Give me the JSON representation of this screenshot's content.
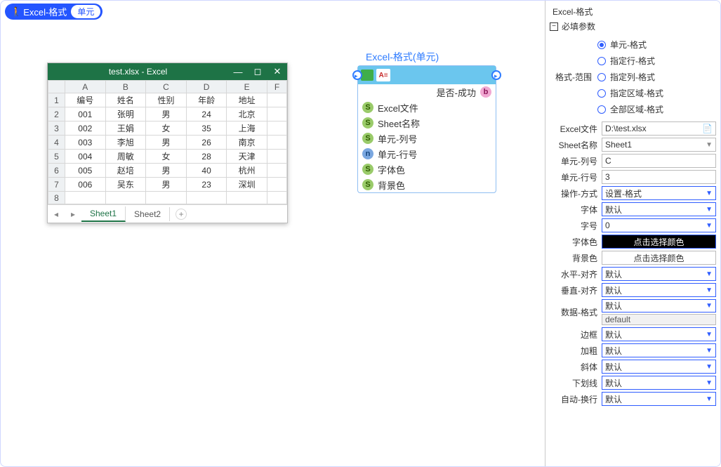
{
  "topTag": {
    "label": "Excel-格式",
    "pill": "单元"
  },
  "excel": {
    "title": "test.xlsx  -  Excel",
    "cols": [
      "A",
      "B",
      "C",
      "D",
      "E",
      "F"
    ],
    "headers": [
      "编号",
      "姓名",
      "性别",
      "年龄",
      "地址"
    ],
    "rows": [
      [
        "001",
        "张明",
        "男",
        "24",
        "北京"
      ],
      [
        "002",
        "王娟",
        "女",
        "35",
        "上海"
      ],
      [
        "003",
        "李旭",
        "男",
        "26",
        "南京"
      ],
      [
        "004",
        "周敏",
        "女",
        "28",
        "天津"
      ],
      [
        "005",
        "赵培",
        "男",
        "40",
        "杭州"
      ],
      [
        "006",
        "吴东",
        "男",
        "23",
        "深圳"
      ]
    ],
    "sheets": [
      "Sheet1",
      "Sheet2"
    ]
  },
  "node": {
    "title": "Excel-格式(单元)",
    "iconLabel": "A≡",
    "output": "是否-成功",
    "inputs": [
      {
        "badge": "s",
        "label": "Excel文件"
      },
      {
        "badge": "s",
        "label": "Sheet名称"
      },
      {
        "badge": "s",
        "label": "单元-列号"
      },
      {
        "badge": "n",
        "label": "单元-行号"
      },
      {
        "badge": "s",
        "label": "字体色"
      },
      {
        "badge": "s",
        "label": "背景色"
      }
    ]
  },
  "panel": {
    "title": "Excel-格式",
    "sectionRequired": "必填参数",
    "scopeLabel": "格式-范围",
    "scopeOptions": [
      "单元-格式",
      "指定行-格式",
      "指定列-格式",
      "指定区域-格式",
      "全部区域-格式"
    ],
    "scopeSelected": "单元-格式",
    "fields": {
      "excelFile": {
        "label": "Excel文件",
        "value": "D:\\test.xlsx"
      },
      "sheetName": {
        "label": "Sheet名称",
        "value": "Sheet1"
      },
      "cellCol": {
        "label": "单元-列号",
        "value": "C"
      },
      "cellRow": {
        "label": "单元-行号",
        "value": "3"
      },
      "opMode": {
        "label": "操作-方式",
        "value": "设置-格式"
      },
      "font": {
        "label": "字体",
        "value": "默认"
      },
      "fontSize": {
        "label": "字号",
        "value": "0"
      },
      "fontColor": {
        "label": "字体色",
        "value": "点击选择颜色"
      },
      "bgColor": {
        "label": "背景色",
        "value": "点击选择颜色"
      },
      "hAlign": {
        "label": "水平-对齐",
        "value": "默认"
      },
      "vAlign": {
        "label": "垂直-对齐",
        "value": "默认"
      },
      "dataFmt": {
        "label": "数据-格式",
        "value": "默认",
        "value2": "default"
      },
      "border": {
        "label": "边框",
        "value": "默认"
      },
      "bold": {
        "label": "加粗",
        "value": "默认"
      },
      "italic": {
        "label": "斜体",
        "value": "默认"
      },
      "underline": {
        "label": "下划线",
        "value": "默认"
      },
      "wrap": {
        "label": "自动-换行",
        "value": "默认"
      }
    }
  }
}
